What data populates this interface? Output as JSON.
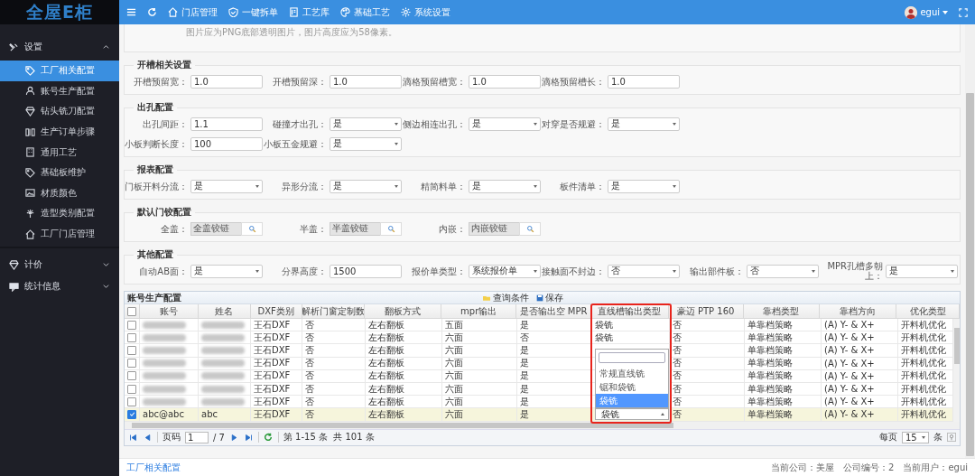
{
  "sidebar": {
    "logo": "全屋E柜",
    "groups": [
      {
        "label": "设置",
        "expanded": true,
        "children": [
          {
            "label": "工厂相关配置",
            "selected": true
          },
          {
            "label": "账号生产配置",
            "selected": false
          },
          {
            "label": "钻头铣刀配置",
            "selected": false
          },
          {
            "label": "生产订单步骤",
            "selected": false
          },
          {
            "label": "通用工艺",
            "selected": false
          },
          {
            "label": "基础板维护",
            "selected": false
          },
          {
            "label": "材质颜色",
            "selected": false
          },
          {
            "label": "造型类别配置",
            "selected": false
          },
          {
            "label": "工厂门店管理",
            "selected": false
          }
        ]
      },
      {
        "label": "计价",
        "expanded": false
      },
      {
        "label": "统计信息",
        "expanded": false
      }
    ]
  },
  "topbar": {
    "nav": [
      {
        "label": "门店管理"
      },
      {
        "label": "一键拆单"
      },
      {
        "label": "工艺库"
      },
      {
        "label": "基础工艺"
      },
      {
        "label": "系统设置"
      }
    ],
    "user": "egui"
  },
  "hint": "图片应为PNG底部透明图片，图片高度应为58像素。",
  "sections": [
    {
      "title": "开槽相关设置",
      "rows": [
        [
          {
            "label": "开槽预留宽：",
            "kind": "text",
            "value": "1.0"
          },
          {
            "label": "开槽预留深：",
            "kind": "text",
            "value": "1.0"
          },
          {
            "label": "滴格预留槽宽：",
            "kind": "text",
            "value": "1.0"
          },
          {
            "label": "滴格预留槽长：",
            "kind": "text",
            "value": "1.0"
          }
        ]
      ]
    },
    {
      "title": "出孔配置",
      "rows": [
        [
          {
            "label": "出孔间距：",
            "kind": "text",
            "value": "1.1"
          },
          {
            "label": "碰撞才出孔：",
            "kind": "select",
            "value": "是"
          },
          {
            "label": "侧边相连出孔：",
            "kind": "select",
            "value": "是"
          },
          {
            "label": "对穿是否规避：",
            "kind": "select",
            "value": "是"
          }
        ],
        [
          {
            "label": "小板判断长度：",
            "kind": "text",
            "value": "100"
          },
          {
            "label": "小板五金规避：",
            "kind": "select",
            "value": "是"
          }
        ]
      ]
    },
    {
      "title": "报表配置",
      "rows": [
        [
          {
            "label": "门板开料分流：",
            "kind": "select",
            "value": "是"
          },
          {
            "label": "异形分流：",
            "kind": "select",
            "value": "是"
          },
          {
            "label": "精简料单：",
            "kind": "select",
            "value": "是"
          },
          {
            "label": "板件清单：",
            "kind": "select",
            "value": "是"
          }
        ]
      ]
    },
    {
      "title": "默认门铰配置",
      "rows": [
        [
          {
            "label": "全盖：",
            "kind": "lookup",
            "value": "全盖铰链",
            "disabled": true
          },
          {
            "label": "半盖：",
            "kind": "lookup",
            "value": "半盖铰链",
            "disabled": true
          },
          {
            "label": "内嵌：",
            "kind": "lookup",
            "value": "内嵌铰链",
            "disabled": true
          }
        ]
      ]
    },
    {
      "title": "其他配置",
      "rows": [
        [
          {
            "label": "自动AB面：",
            "kind": "select",
            "value": "是"
          },
          {
            "label": "分界高度：",
            "kind": "text",
            "value": "1500"
          },
          {
            "label": "报价单类型：",
            "kind": "select",
            "value": "系统报价单"
          },
          {
            "label": "接触面不封边：",
            "kind": "select",
            "value": "否"
          },
          {
            "label": "输出部件板：",
            "kind": "select",
            "value": "否"
          },
          {
            "label": "MPR孔槽多朝上：",
            "kind": "select",
            "value": "是"
          }
        ]
      ]
    }
  ],
  "table": {
    "title": "账号生产配置",
    "actions": [
      {
        "label": "查询条件",
        "kind": "query"
      },
      {
        "label": "保存",
        "kind": "save"
      }
    ],
    "header_checked": false,
    "columns": [
      {
        "label": "账号"
      },
      {
        "label": "姓名"
      },
      {
        "label": "DXF类别"
      },
      {
        "label": "解析门窗定制数"
      },
      {
        "label": "翻板方式"
      },
      {
        "label": "mpr输出"
      },
      {
        "label": "是否输出空 MPR"
      },
      {
        "label": "直线槽输出类型",
        "kind": "select",
        "highlighted": true
      },
      {
        "label": "豪迈 PTP 160"
      },
      {
        "label": "靠档类型"
      },
      {
        "label": "靠档方向"
      },
      {
        "label": "优化类型"
      }
    ],
    "rows": [
      {
        "checked": false,
        "selected": false,
        "blurred": true,
        "editing": false,
        "cells": [
          null,
          null,
          "王石DXF",
          "否",
          "左右翻板",
          "五面",
          "是",
          "袋铣",
          "否",
          "单靠档策略",
          "(A) Y- & X+",
          "开料机优化"
        ]
      },
      {
        "checked": false,
        "selected": false,
        "blurred": true,
        "editing": false,
        "cells": [
          null,
          null,
          "王石DXF",
          "否",
          "左右翻板",
          "六面",
          "否",
          "袋铣",
          "否",
          "单靠档策略",
          "(A) Y- & X+",
          "开料机优化"
        ]
      },
      {
        "checked": false,
        "selected": false,
        "blurred": true,
        "editing": false,
        "cells": [
          null,
          null,
          "王石DXF",
          "否",
          "左右翻板",
          "六面",
          "是",
          null,
          "否",
          "单靠档策略",
          "(A) Y- & X+",
          "开料机优化"
        ]
      },
      {
        "checked": false,
        "selected": false,
        "blurred": true,
        "editing": false,
        "cells": [
          null,
          null,
          "王石DXF",
          "否",
          "左右翻板",
          "六面",
          "是",
          null,
          "否",
          "单靠档策略",
          "(A) Y- & X+",
          "开料机优化"
        ]
      },
      {
        "checked": false,
        "selected": false,
        "blurred": true,
        "editing": false,
        "cells": [
          null,
          null,
          "王石DXF",
          "否",
          "左右翻板",
          "六面",
          "是",
          null,
          "否",
          "单靠档策略",
          "(A) Y- & X+",
          "开料机优化"
        ]
      },
      {
        "checked": false,
        "selected": false,
        "blurred": true,
        "editing": false,
        "cells": [
          null,
          null,
          "王石DXF",
          "否",
          "左右翻板",
          "六面",
          "是",
          null,
          "否",
          "单靠档策略",
          "(A) Y- & X+",
          "开料机优化"
        ]
      },
      {
        "checked": false,
        "selected": false,
        "blurred": true,
        "editing": false,
        "cells": [
          null,
          null,
          "王石DXF",
          "否",
          "左右翻板",
          "六面",
          "是",
          null,
          "否",
          "单靠档策略",
          "(A) Y- & X+",
          "开料机优化"
        ]
      },
      {
        "checked": true,
        "selected": true,
        "blurred": false,
        "editing": true,
        "cells": [
          "abc@abc",
          "abc",
          "王石DXF",
          "否",
          "左右翻板",
          "六面",
          "是",
          "袋铣",
          "否",
          "单靠档策略",
          "(A) Y- & X+",
          "开料机优化"
        ]
      }
    ],
    "dropdown": {
      "options": [
        {
          "label": "常规直线铣",
          "selected": false
        },
        {
          "label": "锯和袋铣",
          "selected": false
        },
        {
          "label": "袋铣",
          "selected": true
        }
      ]
    },
    "pager": {
      "page_label": "页码",
      "page": "1",
      "total_pages": "/ 7",
      "summary": "第 1-15 条  共 101 条",
      "per_page_label": "每页",
      "per_page": "15",
      "per_page_unit": "条"
    }
  },
  "footer": {
    "breadcrumb": "工厂相关配置",
    "status": [
      "当前公司：美屋",
      "公司编号：2",
      "当前用户：egui"
    ]
  }
}
